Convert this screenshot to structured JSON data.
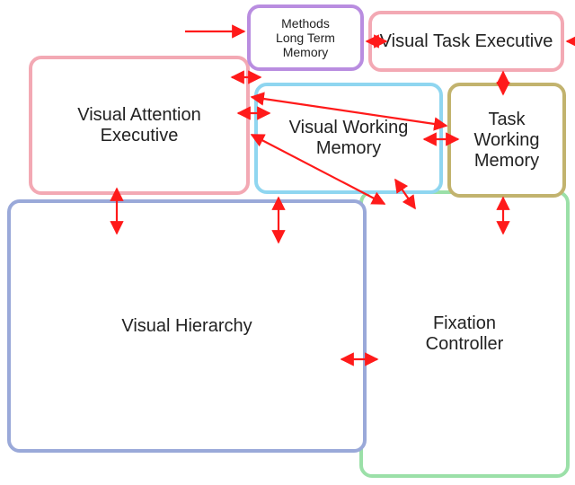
{
  "diagram": {
    "boxes": {
      "methods": {
        "label": "Methods\nLong Term\nMemory",
        "color": "#b98de0"
      },
      "vte": {
        "label": "Visual Task Executive",
        "color": "#f3a9b4"
      },
      "vae": {
        "label": "Visual Attention\nExecutive",
        "color": "#f3a9b4"
      },
      "vwm": {
        "label": "Visual Working\nMemory",
        "color": "#8fd6f0"
      },
      "twm": {
        "label": "Task Working\nMemory",
        "color": "#c2b36e"
      },
      "vh": {
        "label": "Visual Hierarchy",
        "color": "#9aa9d9"
      },
      "fc": {
        "label": "Fixation\nController",
        "color": "#9be0a8"
      }
    },
    "arrow_color": "#ff1a1a",
    "connections": [
      {
        "from": "external-left",
        "to": "methods",
        "bidirectional": false
      },
      {
        "from": "external-right",
        "to": "vte",
        "bidirectional": false
      },
      {
        "from": "vte",
        "to": "methods",
        "bidirectional": true
      },
      {
        "from": "vae",
        "to": "methods",
        "bidirectional": true
      },
      {
        "from": "vae",
        "to": "vwm",
        "bidirectional": true
      },
      {
        "from": "vae",
        "to": "twm",
        "bidirectional": true
      },
      {
        "from": "vae",
        "to": "fc",
        "bidirectional": true
      },
      {
        "from": "vwm",
        "to": "twm",
        "bidirectional": true
      },
      {
        "from": "vte",
        "to": "twm",
        "bidirectional": true
      },
      {
        "from": "vae",
        "to": "vh",
        "bidirectional": true
      },
      {
        "from": "vwm",
        "to": "vh",
        "bidirectional": true
      },
      {
        "from": "twm",
        "to": "fc",
        "bidirectional": true
      },
      {
        "from": "vwm",
        "to": "fc",
        "bidirectional": true
      },
      {
        "from": "vh",
        "to": "fc",
        "bidirectional": true
      }
    ]
  }
}
